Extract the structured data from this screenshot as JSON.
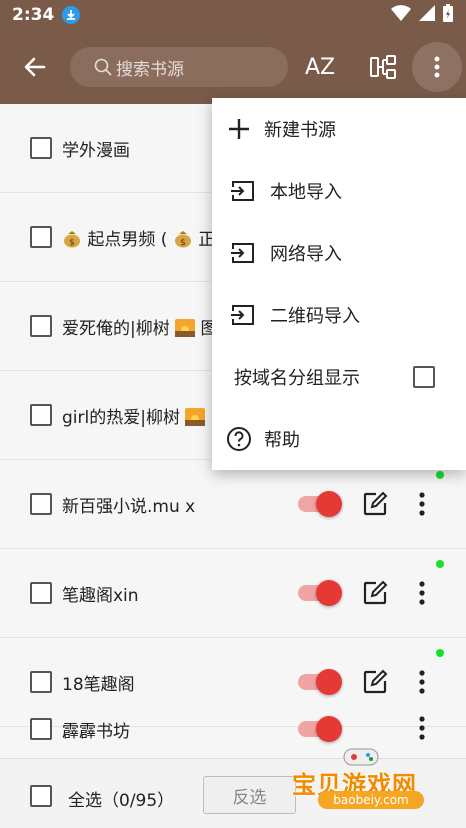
{
  "status_bar": {
    "time": "2:34"
  },
  "toolbar": {
    "search_placeholder": "搜索书源",
    "sort_icon_label": "AZ"
  },
  "list": {
    "items": [
      {
        "name": "学外漫画",
        "enabled": null,
        "has_update_dot": false
      },
      {
        "name_pre": "",
        "name": "起点男频 (",
        "name_mid": " 正",
        "has_update_dot": false
      },
      {
        "name": "爱死俺的|柳树",
        "name_post": "图",
        "has_update_dot": false
      },
      {
        "name": "girl的热爱|柳树",
        "name_post": "图",
        "has_update_dot": false
      },
      {
        "name": "新百强小说.mu x",
        "enabled": true,
        "has_update_dot": true
      },
      {
        "name": "笔趣阁xin",
        "enabled": true,
        "has_update_dot": true
      },
      {
        "name": "18笔趣阁",
        "enabled": true,
        "has_update_dot": true
      },
      {
        "name": "霹霹书坊",
        "enabled": true,
        "has_update_dot": false
      }
    ]
  },
  "bottom_bar": {
    "select_all_label": "全选（0/95）",
    "invert_label": "反选"
  },
  "menu": {
    "items": [
      {
        "label": "新建书源",
        "icon": "plus-icon"
      },
      {
        "label": "本地导入",
        "icon": "import-icon"
      },
      {
        "label": "网络导入",
        "icon": "import-icon"
      },
      {
        "label": "二维码导入",
        "icon": "import-icon"
      },
      {
        "label": "按域名分组显示",
        "icon": "checkbox",
        "checked": false
      },
      {
        "label": "帮助",
        "icon": "help-icon"
      }
    ]
  },
  "watermark": {
    "text": "宝贝游戏网",
    "subtext": "baobeiy.com"
  },
  "colors": {
    "toolbar_bg": "#7a5b4a",
    "accent_red": "#e53935",
    "update_dot": "#18e02a",
    "watermark_orange": "#f28b00"
  }
}
